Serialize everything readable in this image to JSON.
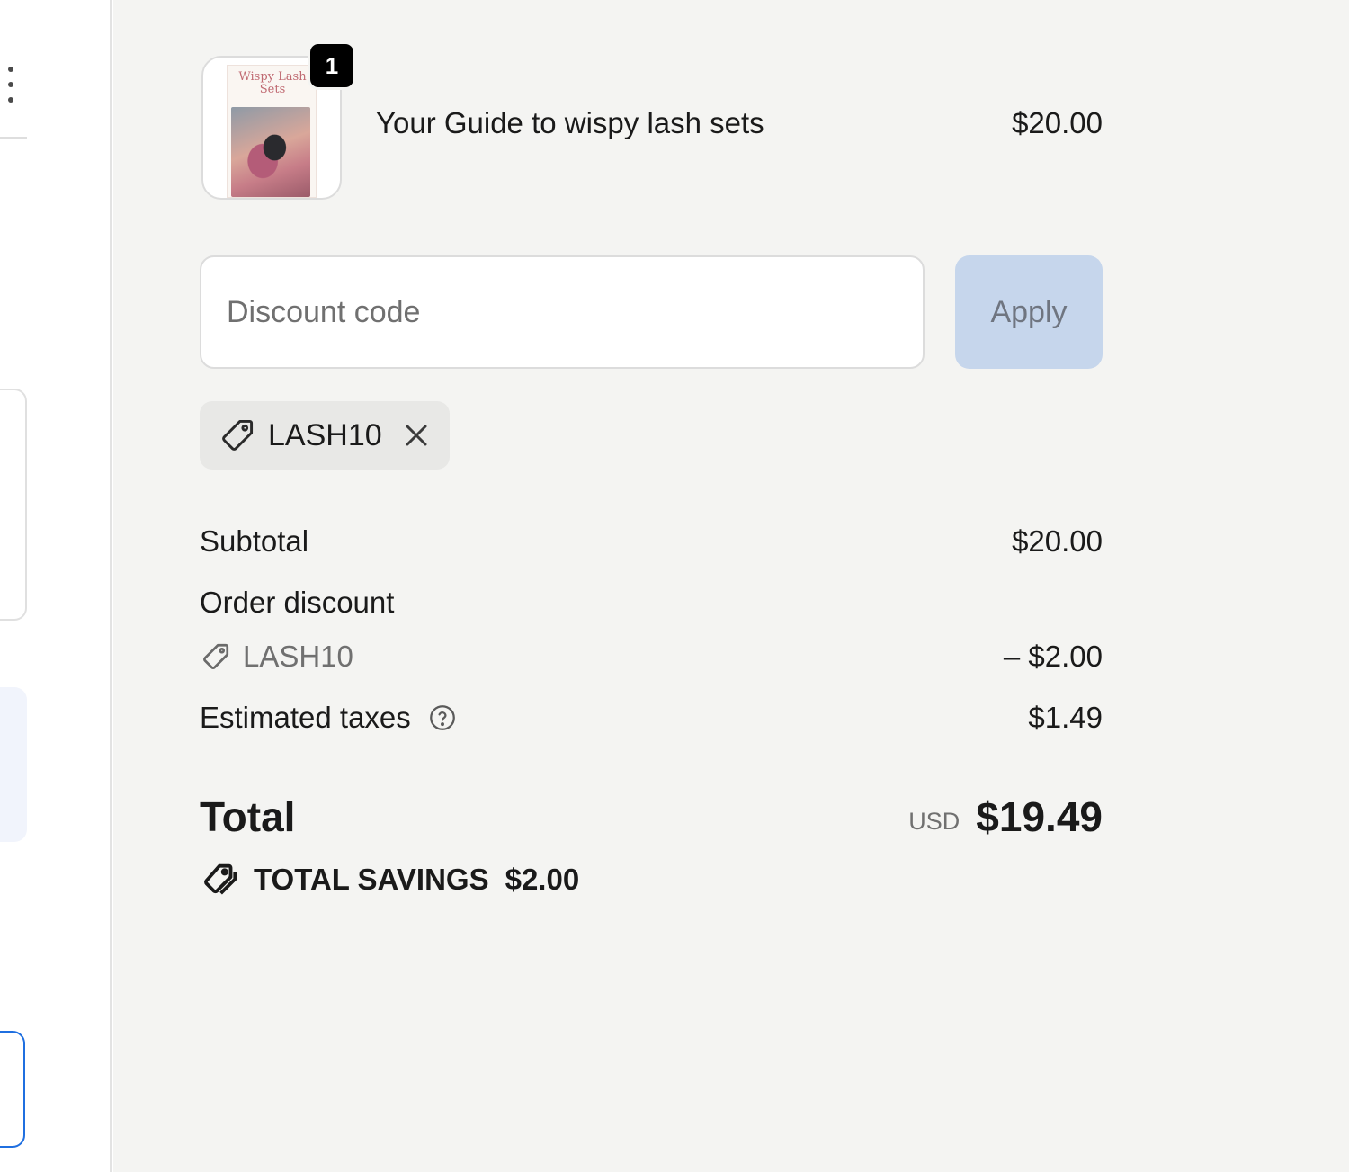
{
  "cart": {
    "items": [
      {
        "name": "Your Guide to wispy lash sets",
        "price": "$20.00",
        "quantity": "1",
        "image_title": "Wispy Lash Sets"
      }
    ]
  },
  "discount": {
    "placeholder": "Discount code",
    "apply_label": "Apply",
    "applied_code": "LASH10"
  },
  "summary": {
    "subtotal_label": "Subtotal",
    "subtotal_value": "$20.00",
    "order_discount_label": "Order discount",
    "discount_code": "LASH10",
    "discount_value": "– $2.00",
    "taxes_label": "Estimated taxes",
    "taxes_value": "$1.49",
    "total_label": "Total",
    "currency": "USD",
    "total_value": "$19.49",
    "savings_label": "TOTAL SAVINGS",
    "savings_value": "$2.00"
  },
  "icons": {
    "tag": "tag-icon",
    "close": "close-icon",
    "help": "question-circle-icon",
    "savings": "double-tag-icon",
    "menu": "kebab-menu-icon"
  },
  "colors": {
    "summary_bg": "#f4f4f2",
    "apply_bg": "#c6d6ec",
    "badge_bg": "#000000",
    "focus_border": "#1f6fe0"
  }
}
